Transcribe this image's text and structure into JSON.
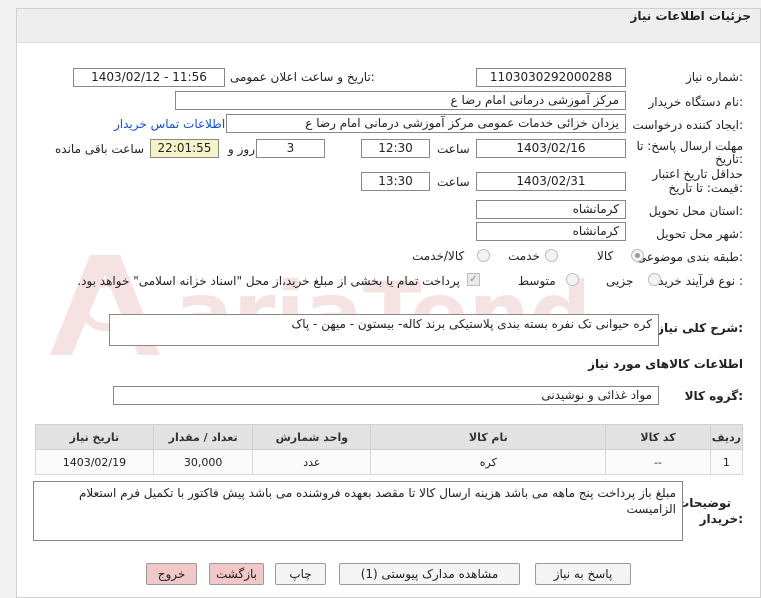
{
  "header": {
    "title": "جزئیات اطلاعات نیاز"
  },
  "fields": {
    "need_number_label": "شماره نیاز:",
    "need_number": "1103030292000288",
    "announce_label": "تاریخ و ساعت اعلان عمومی:",
    "announce_value": "1403/02/12 - 11:56",
    "buyer_org_label": "نام دستگاه خریدار:",
    "buyer_org": "مرکز آموزشی  درمانی امام رضا  ع",
    "requester_label": "ایجاد کننده درخواست:",
    "requester": "یزدان خزائی خدمات عمومی مرکز آموزشی  درمانی امام رضا  ع",
    "contact_link": "اطلاعات تماس خریدار",
    "deadline_label_1": "مهلت ارسال پاسخ: تا",
    "deadline_label_2": "تاریخ:",
    "deadline_date": "1403/02/16",
    "time_label": "ساعت",
    "deadline_time": "12:30",
    "days_value": "3",
    "days_label": "روز و",
    "remaining_value": "22:01:55",
    "remaining_label": "ساعت باقی مانده",
    "validity_label_1": "حداقل تاریخ اعتبار",
    "validity_label_2": "قیمت: تا تاریخ:",
    "validity_date": "1403/02/31",
    "validity_time": "13:30",
    "province_label": "استان محل تحویل:",
    "province": "کرمانشاه",
    "city_label": "شهر محل تحویل:",
    "city": "کرمانشاه",
    "category_label": "طبقه بندی موضوعی:",
    "category_options": [
      "کالا",
      "خدمت",
      "کالا/خدمت"
    ],
    "purchase_type_label": "نوع فرآیند خرید :",
    "purchase_options": [
      "جزیی",
      "متوسط"
    ],
    "treasury_note": "پرداخت تمام یا بخشی از مبلغ خرید،از محل \"اسناد خزانه اسلامی\" خواهد بود."
  },
  "description": {
    "label": "شرح کلی نیاز:",
    "text": "کره حیوانی تک نفره  بسته بندی پلاستیکی  برند  کاله-  بیستون - میهن - پاک"
  },
  "goods_info": {
    "title": "اطلاعات کالاهای مورد نیاز"
  },
  "goods_group": {
    "label": "گروه کالا:",
    "value": "مواد غذائی و نوشیدنی"
  },
  "table": {
    "headers": [
      "ردیف",
      "کد کالا",
      "نام کالا",
      "واحد شمارش",
      "تعداد / مقدار",
      "تاریخ نیاز"
    ],
    "rows": [
      [
        "1",
        "--",
        "کره",
        "عدد",
        "30,000",
        "1403/02/19"
      ]
    ]
  },
  "buyer_notes": {
    "label_1": "توضیحات",
    "label_2": "خریدار:",
    "text": "مبلغ باز پرداخت پنج ماهه می باشد هزینه ارسال کالا تا مقصد بعهده فروشنده می باشد پیش فاکتور با تکمیل فرم استعلام الزامیست"
  },
  "buttons": {
    "reply": "پاسخ به نیاز",
    "docs": "مشاهده مدارک پیوستی (1)",
    "print": "چاپ",
    "back": "بازگشت",
    "exit": "خروج"
  },
  "watermark": {
    "text": "AriaTender.net"
  },
  "colors": {
    "accent_link": "#1a4fcc",
    "pink_button": "#f2c7c7",
    "highlight": "#f7f3c8"
  }
}
